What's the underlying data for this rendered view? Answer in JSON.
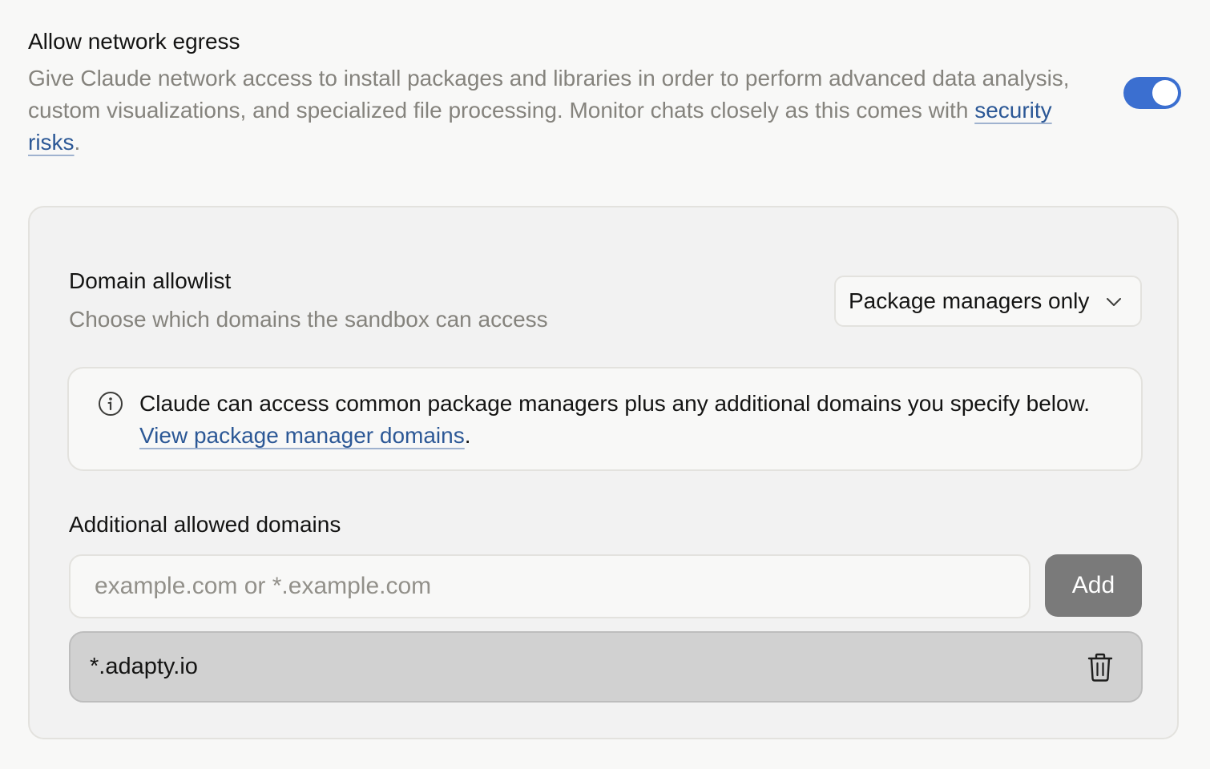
{
  "egress": {
    "title": "Allow network egress",
    "description_prefix": "Give Claude network access to install packages and libraries in order to perform advanced data analysis, custom visualizations, and specialized file processing. Monitor chats closely as this comes with ",
    "link_label": "security risks",
    "description_suffix": ".",
    "toggle_on": true,
    "toggle_color": "#3b6fd0"
  },
  "allowlist": {
    "title": "Domain allowlist",
    "subtitle": "Choose which domains the sandbox can access",
    "select_value": "Package managers only"
  },
  "info": {
    "icon": "info-circle-icon",
    "text_prefix": "Claude can access common package managers plus any additional domains you specify below. ",
    "link_label": "View package manager domains",
    "text_suffix": "."
  },
  "additional": {
    "title": "Additional allowed domains",
    "input_value": "",
    "input_placeholder": "example.com or *.example.com",
    "add_label": "Add",
    "domains": [
      "*.adapty.io"
    ],
    "remove_icon": "trash-icon"
  }
}
